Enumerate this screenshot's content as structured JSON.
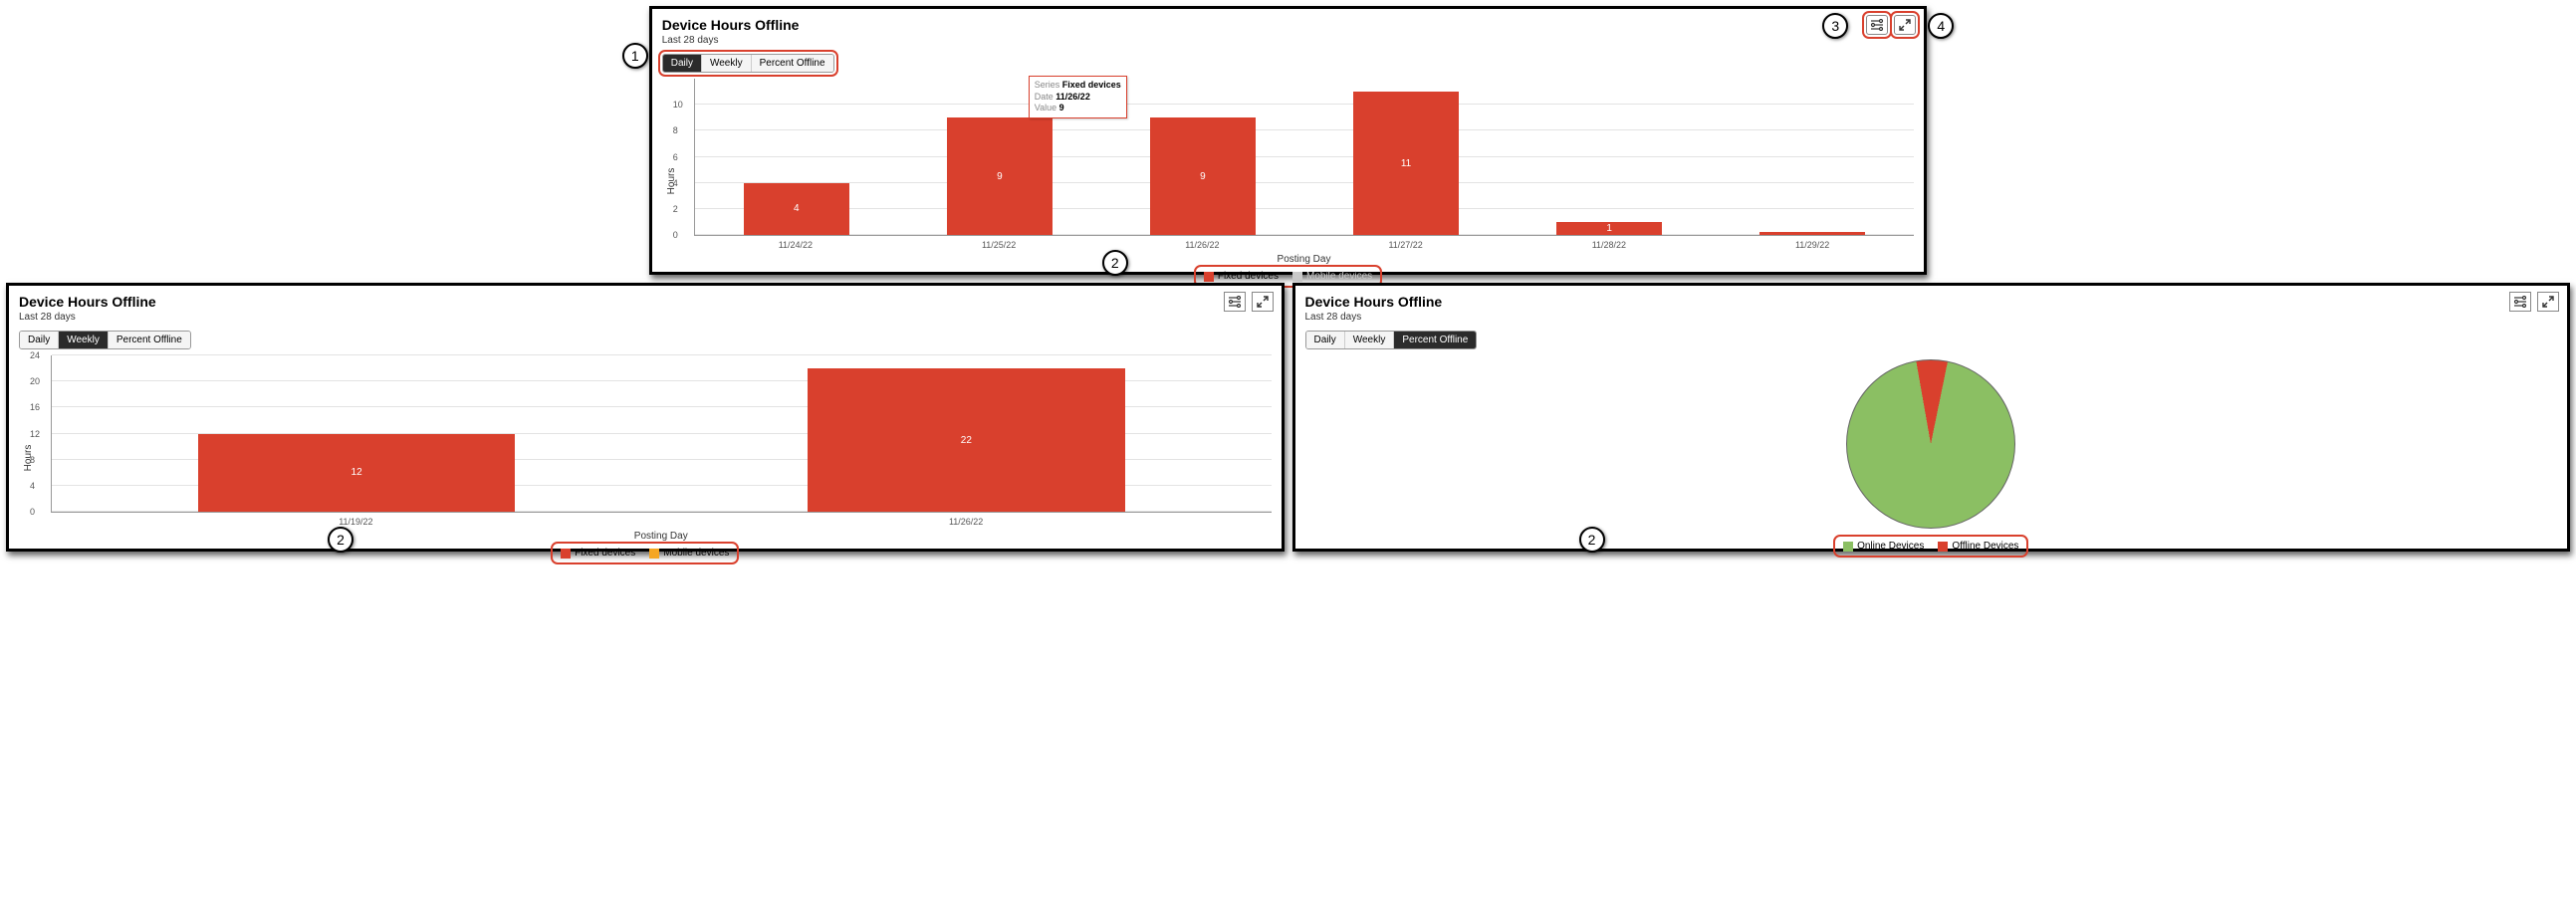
{
  "panels": {
    "daily": {
      "title": "Device Hours Offline",
      "subtitle": "Last 28 days",
      "tabs": {
        "daily": "Daily",
        "weekly": "Weekly",
        "percent": "Percent Offline"
      },
      "active_tab": "daily",
      "ylabel": "Hours",
      "xlabel": "Posting Day",
      "legend": {
        "fixed": "Fixed devices",
        "mobile": "Mobile devices"
      },
      "tooltip": {
        "series_label": "Series",
        "series_value": "Fixed devices",
        "date_label": "Date",
        "date_value": "11/26/22",
        "value_label": "Value",
        "value_value": "9"
      }
    },
    "weekly": {
      "title": "Device Hours Offline",
      "subtitle": "Last 28 days",
      "tabs": {
        "daily": "Daily",
        "weekly": "Weekly",
        "percent": "Percent Offline"
      },
      "active_tab": "weekly",
      "ylabel": "Hours",
      "xlabel": "Posting Day",
      "legend": {
        "fixed": "Fixed devices",
        "mobile": "Mobile devices"
      }
    },
    "percent": {
      "title": "Device Hours Offline",
      "subtitle": "Last 28 days",
      "tabs": {
        "daily": "Daily",
        "weekly": "Weekly",
        "percent": "Percent Offline"
      },
      "active_tab": "percent",
      "legend": {
        "online": "Online Devices",
        "offline": "Offline Devices"
      }
    }
  },
  "annotations": {
    "a1": "1",
    "a2": "2",
    "a3": "3",
    "a4": "4"
  },
  "colors": {
    "red": "#D9402D",
    "green": "#8BBF63",
    "orange": "#F5A623",
    "grey_off": "#C9C9C9"
  },
  "chart_data": [
    {
      "id": "daily",
      "type": "bar",
      "title": "Device Hours Offline",
      "subtitle": "Last 28 days",
      "xlabel": "Posting Day",
      "ylabel": "Hours",
      "ylim": [
        0,
        12
      ],
      "yticks": [
        0,
        2,
        4,
        6,
        8,
        10
      ],
      "categories": [
        "11/24/22",
        "11/25/22",
        "11/26/22",
        "11/27/22",
        "11/28/22",
        "11/29/22"
      ],
      "series": [
        {
          "name": "Fixed devices",
          "color": "#D9402D",
          "values": [
            4,
            9,
            9,
            11,
            1,
            0.2
          ]
        },
        {
          "name": "Mobile devices",
          "color": "#F5A623",
          "values": [
            null,
            null,
            null,
            null,
            null,
            null
          ],
          "hidden": true
        }
      ]
    },
    {
      "id": "weekly",
      "type": "bar",
      "title": "Device Hours Offline",
      "subtitle": "Last 28 days",
      "xlabel": "Posting Day",
      "ylabel": "Hours",
      "ylim": [
        0,
        24
      ],
      "yticks": [
        0,
        4,
        8,
        12,
        16,
        20,
        24
      ],
      "categories": [
        "11/19/22",
        "11/26/22"
      ],
      "series": [
        {
          "name": "Fixed devices",
          "color": "#D9402D",
          "values": [
            12,
            22
          ]
        },
        {
          "name": "Mobile devices",
          "color": "#F5A623",
          "values": [
            null,
            null
          ]
        }
      ]
    },
    {
      "id": "percent",
      "type": "pie",
      "title": "Device Hours Offline",
      "subtitle": "Last 28 days",
      "series": [
        {
          "name": "Online Devices",
          "color": "#8BBF63",
          "value": 94
        },
        {
          "name": "Offline Devices",
          "color": "#D9402D",
          "value": 6
        }
      ]
    }
  ]
}
